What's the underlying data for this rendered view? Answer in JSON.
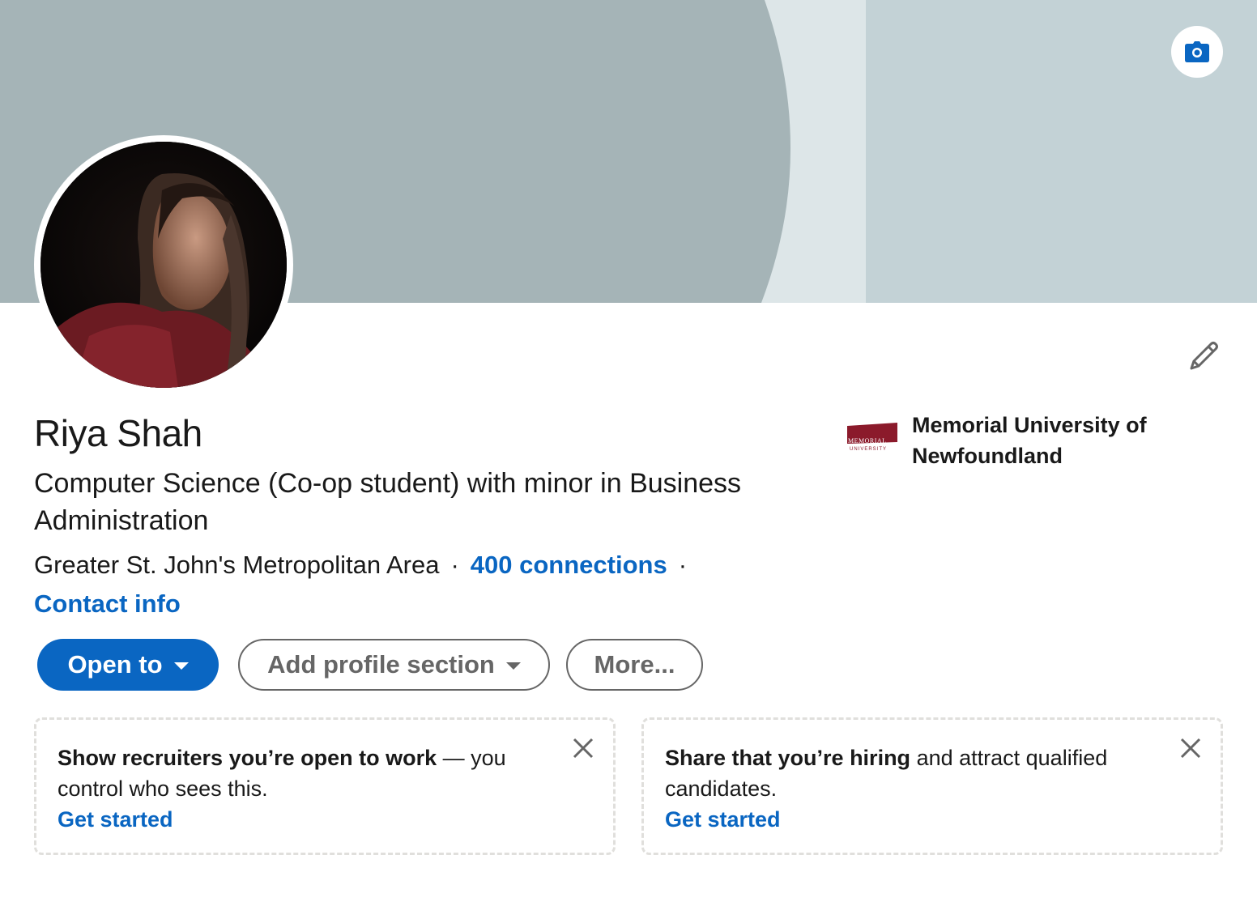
{
  "profile": {
    "name": "Riya Shah",
    "headline": "Computer Science (Co-op student) with minor in Business Administration",
    "location": "Greater St. John's Metropolitan Area",
    "connections": "400 connections",
    "contact_info": "Contact info"
  },
  "education": {
    "name": "Memorial University of Newfoundland",
    "logo_text_top": "MEMORIAL",
    "logo_text_bottom": "UNIVERSITY"
  },
  "actions": {
    "open_to": "Open to",
    "add_profile_section": "Add profile section",
    "more": "More..."
  },
  "cards": [
    {
      "bold": "Show recruiters you’re open to work",
      "rest": " — you control who sees this.",
      "link": "Get started"
    },
    {
      "bold": "Share that you’re hiring",
      "rest": " and attract qualified candidates.",
      "link": "Get started"
    }
  ],
  "icons": {
    "camera": "camera-icon",
    "edit": "pencil-icon",
    "close": "close-icon",
    "dropdown": "caret-down-icon"
  },
  "colors": {
    "brand_blue": "#0a66c2",
    "banner_dark": "#a5b4b7",
    "banner_mid": "#dde6e8",
    "banner_light": "#c3d2d6",
    "university_red": "#8b1a2b"
  }
}
